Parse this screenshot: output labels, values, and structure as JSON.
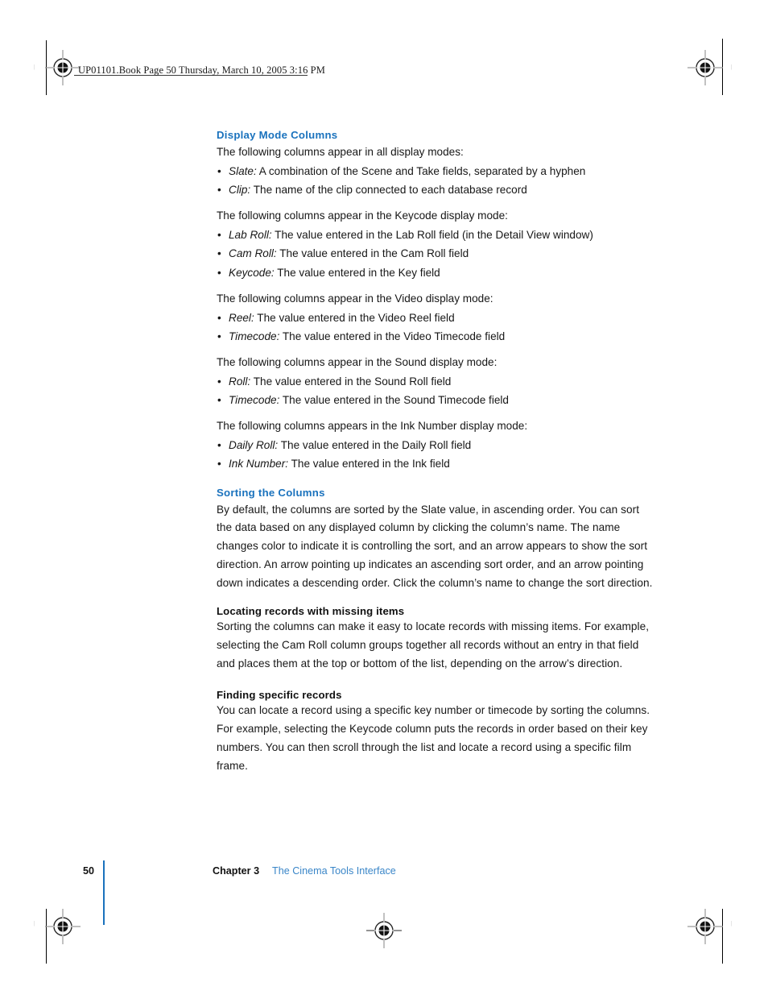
{
  "page": {
    "slug": "UP01101.Book  Page 50  Thursday, March 10, 2005  3:16 PM",
    "folio": "50",
    "footer_chapter": "Chapter 3",
    "footer_chapter_title": "The Cinema Tools Interface",
    "accent_blue": "#1a72bd",
    "footer_link_blue": "#3a86c8",
    "body_color": "#171717"
  },
  "sections": [
    {
      "heading": "Display Mode Columns",
      "lead_in": "The following columns appear in all display modes:",
      "bullets": [
        {
          "term": "Slate:",
          "text": " A combination of the Scene and Take fields, separated by a hyphen"
        },
        {
          "term": "Clip:",
          "text": " The name of the clip connected to each database record"
        }
      ]
    }
  ],
  "groups": [
    {
      "lead_in": "The following columns appear in the Keycode display mode:",
      "bullets": [
        {
          "term": "Lab Roll:",
          "text": " The value entered in the Lab Roll field (in the Detail View window)"
        },
        {
          "term": "Cam Roll:",
          "text": " The value entered in the Cam Roll field"
        },
        {
          "term": "Keycode:",
          "text": " The value entered in the Key field"
        }
      ]
    },
    {
      "lead_in": "The following columns appear in the Video display mode:",
      "bullets": [
        {
          "term": "Reel:",
          "text": " The value entered in the Video Reel field"
        },
        {
          "term": "Timecode:",
          "text": " The value entered in the Video Timecode field"
        }
      ]
    },
    {
      "lead_in": "The following columns appear in the Sound display mode:",
      "bullets": [
        {
          "term": "Roll:",
          "text": " The value entered in the Sound Roll field"
        },
        {
          "term": "Timecode:",
          "text": " The value entered in the Sound Timecode field"
        }
      ]
    },
    {
      "lead_in": "The following columns appears in the Ink Number display mode:",
      "bullets": [
        {
          "term": "Daily Roll:",
          "text": " The value entered in the Daily Roll field"
        },
        {
          "term": "Ink Number:",
          "text": " The value entered in the Ink field"
        }
      ]
    }
  ],
  "sorting": {
    "heading": "Sorting the Columns",
    "body": "By default, the columns are sorted by the Slate value, in ascending order. You can sort the data based on any displayed column by clicking the column’s name. The name changes color to indicate it is controlling the sort, and an arrow appears to show the sort direction. An arrow pointing up indicates an ascending sort order, and an arrow pointing down indicates a descending order. Click the column’s name to change the sort direction.",
    "subsections": [
      {
        "heading": "Locating records with missing items",
        "body": "Sorting the columns can make it easy to locate records with missing items. For example, selecting the Cam Roll column groups together all records without an entry in that field and places them at the top or bottom of the list, depending on the arrow’s direction."
      },
      {
        "heading": "Finding specific records",
        "body": "You can locate a record using a specific key number or timecode by sorting the columns. For example, selecting the Keycode column puts the records in order based on their key numbers. You can then scroll through the list and locate a record using a specific film frame."
      }
    ]
  },
  "bullet_glyph": "•"
}
